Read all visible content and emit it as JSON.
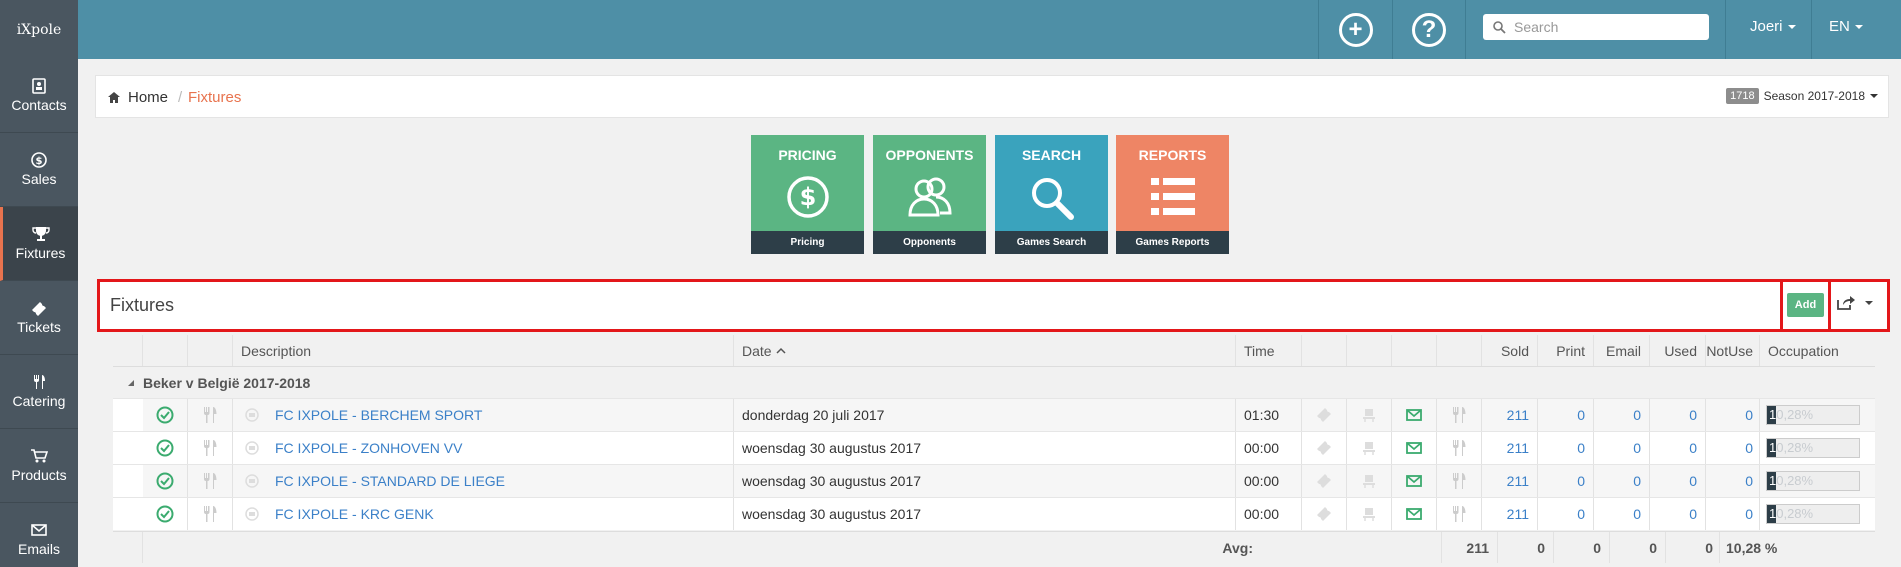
{
  "app": {
    "logo": "iXpole"
  },
  "topbar": {
    "search_placeholder": "Search",
    "user": "Joeri",
    "language": "EN"
  },
  "sidebar": {
    "items": [
      {
        "label": "Contacts",
        "icon": "contact-card-icon"
      },
      {
        "label": "Sales",
        "icon": "dollar-circle-icon"
      },
      {
        "label": "Fixtures",
        "icon": "trophy-icon",
        "active": true
      },
      {
        "label": "Tickets",
        "icon": "ticket-icon"
      },
      {
        "label": "Catering",
        "icon": "cutlery-icon"
      },
      {
        "label": "Products",
        "icon": "cart-icon"
      },
      {
        "label": "Emails",
        "icon": "envelope-icon"
      }
    ]
  },
  "breadcrumb": {
    "home": "Home",
    "separator": "/",
    "current": "Fixtures"
  },
  "season": {
    "badge": "1718",
    "label": "Season 2017-2018"
  },
  "tiles": [
    {
      "title": "PRICING",
      "footer": "Pricing",
      "color": "#5bb583",
      "icon": "dollar-circle-icon"
    },
    {
      "title": "OPPONENTS",
      "footer": "Opponents",
      "color": "#5bb583",
      "icon": "users-icon"
    },
    {
      "title": "SEARCH",
      "footer": "Games Search",
      "color": "#3aa3bd",
      "icon": "magnifier-icon"
    },
    {
      "title": "REPORTS",
      "footer": "Games Reports",
      "color": "#ee8565",
      "icon": "list-icon"
    }
  ],
  "panel": {
    "title": "Fixtures",
    "add_label": "Add"
  },
  "table": {
    "headers": {
      "description": "Description",
      "date": "Date",
      "time": "Time",
      "sold": "Sold",
      "print": "Print",
      "email": "Email",
      "used": "Used",
      "notuse": "NotUse",
      "occupation": "Occupation"
    },
    "group": "Beker v België 2017-2018",
    "rows": [
      {
        "description": "FC IXPOLE - BERCHEM SPORT",
        "date": "donderdag 20 juli 2017",
        "time": "01:30",
        "sold": "211",
        "print": "0",
        "email": "0",
        "used": "0",
        "notuse": "0",
        "occupation": "10,28%",
        "occ_visible": "1",
        "occ_faded": "0,28%"
      },
      {
        "description": "FC IXPOLE - ZONHOVEN VV",
        "date": "woensdag 30 augustus 2017",
        "time": "00:00",
        "sold": "211",
        "print": "0",
        "email": "0",
        "used": "0",
        "notuse": "0",
        "occupation": "10,28%",
        "occ_visible": "1",
        "occ_faded": "0,28%"
      },
      {
        "description": "FC IXPOLE - STANDARD DE LIEGE",
        "date": "woensdag 30 augustus 2017",
        "time": "00:00",
        "sold": "211",
        "print": "0",
        "email": "0",
        "used": "0",
        "notuse": "0",
        "occupation": "10,28%",
        "occ_visible": "1",
        "occ_faded": "0,28%"
      },
      {
        "description": "FC IXPOLE - KRC GENK",
        "date": "woensdag 30 augustus 2017",
        "time": "00:00",
        "sold": "211",
        "print": "0",
        "email": "0",
        "used": "0",
        "notuse": "0",
        "occupation": "10,28%",
        "occ_visible": "1",
        "occ_faded": "0,28%"
      }
    ],
    "footer": {
      "label": "Avg:",
      "sold": "211",
      "print": "0",
      "email": "0",
      "used": "0",
      "notuse": "0",
      "occupation": "10,28 %"
    }
  }
}
